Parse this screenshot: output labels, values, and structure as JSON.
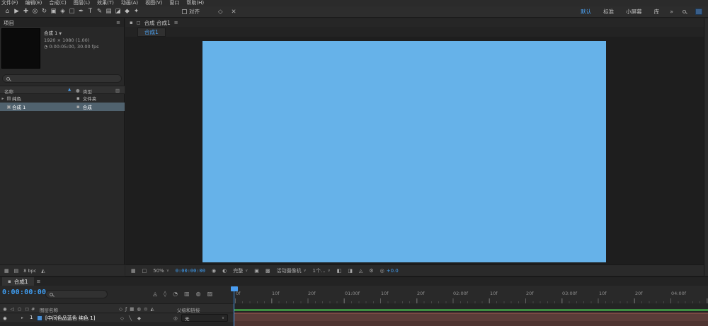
{
  "colors": {
    "accent": "#3f9ef3",
    "solid_blue": "#66b2e9",
    "cache_line_green": "#3e8e41",
    "layer_band_maroon": "#5a3c38",
    "selected_row": "#50626e"
  },
  "icons": {
    "hamburger": "≡",
    "caret_down": "▼",
    "caret_right": "▸",
    "sort_asc": "▲",
    "dropdown_arrow": "∨",
    "overflow": "»",
    "folder": "▤",
    "composition": "▣",
    "type_chip": "▪",
    "label_dot": "●",
    "list_options": "▥",
    "duration": "◔",
    "eye": "◉",
    "audio": "◁",
    "solo": "○",
    "lock": "◻",
    "pick_whip": "◎",
    "grid": "▦",
    "mask_paths": "□",
    "snapshot": "◉",
    "show_snapshot": "◐",
    "roi": "▣",
    "transparency_grid": "▩",
    "pixel_aspect": "◧",
    "fast_previews": "◨",
    "gear": "⚙",
    "exposure": "◎",
    "quality": "◇",
    "fx": "ƒ",
    "frame_blend": "▦",
    "motion_blur": "◍",
    "adjustment": "⊙",
    "threed": "◭",
    "collapse": "◬",
    "slash": "╲",
    "diamond": "◆",
    "footer_a": "▦",
    "footer_b": "▤",
    "footer_c": "◭",
    "tlc_flowchart": "◬",
    "tlc_draft3d": "◊",
    "tlc_shy": "◔",
    "tlc_blend": "▥",
    "tlc_blur": "◍",
    "tlc_graph": "▨",
    "panel_square": "▪"
  },
  "app": {
    "menu": [
      "文件(F)",
      "编辑(E)",
      "合成(C)",
      "图层(L)",
      "效果(T)",
      "动画(A)",
      "视图(V)",
      "窗口",
      "帮助(H)"
    ],
    "workspaces": [
      "默认",
      "标准",
      "小屏幕",
      "库"
    ]
  },
  "toolbar": {
    "snap_label": "对齐",
    "tools": [
      "⌂",
      "▶",
      "✚",
      "◎",
      "↻",
      "▣",
      "◈",
      "□",
      "✒",
      "T",
      "✎",
      "▤",
      "◪",
      "◆",
      "✦"
    ]
  },
  "project": {
    "panel_title": "项目",
    "comp_name": "合成 1",
    "info_size": "1920 × 1080 (1.00)",
    "info_duration": "0:00:05:00, 30.00 fps",
    "col_name": "名称",
    "col_type": "类型",
    "rows": [
      {
        "name": "纯色",
        "type": "文件夹"
      },
      {
        "name": "合成 1",
        "type": "合成"
      }
    ],
    "depth": "8 bpc"
  },
  "comp": {
    "panel_title": "合成 合成1",
    "breadcrumb": "合成1",
    "zoom": "50%",
    "timecode": "0:00:00:00",
    "resolution": "完整",
    "camera": "活动摄像机",
    "views": "1个...",
    "exposure": "+0.0"
  },
  "timeline": {
    "tab": "合成1",
    "timecode": "0:00:00:00",
    "col_index": "#",
    "col_layer": "图层名称",
    "col_parent": "父级和链接",
    "layer": {
      "num": "1",
      "name": "[中间色品蓝色 纯色 1]",
      "parent": "无"
    },
    "ruler": [
      "0f",
      "10f",
      "20f",
      "01:00f",
      "10f",
      "20f",
      "02:00f",
      "10f",
      "20f",
      "03:00f",
      "10f",
      "20f",
      "04:00f"
    ]
  }
}
